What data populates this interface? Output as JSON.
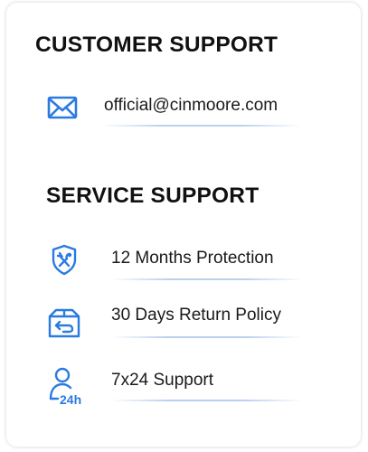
{
  "customer_support": {
    "heading": "CUSTOMER SUPPORT",
    "email": {
      "icon": "envelope-icon",
      "text": "official@cinmoore.com"
    }
  },
  "service_support": {
    "heading": "SERVICE SUPPORT",
    "items": [
      {
        "icon": "shield-tools-icon",
        "label": "12 Months Protection"
      },
      {
        "icon": "return-box-icon",
        "label": "30 Days Return Policy"
      },
      {
        "icon": "person-24h-icon",
        "label": "7x24 Support"
      }
    ]
  },
  "colors": {
    "accent": "#2a7be0",
    "heading": "#111111",
    "text": "#1a1a1a"
  }
}
